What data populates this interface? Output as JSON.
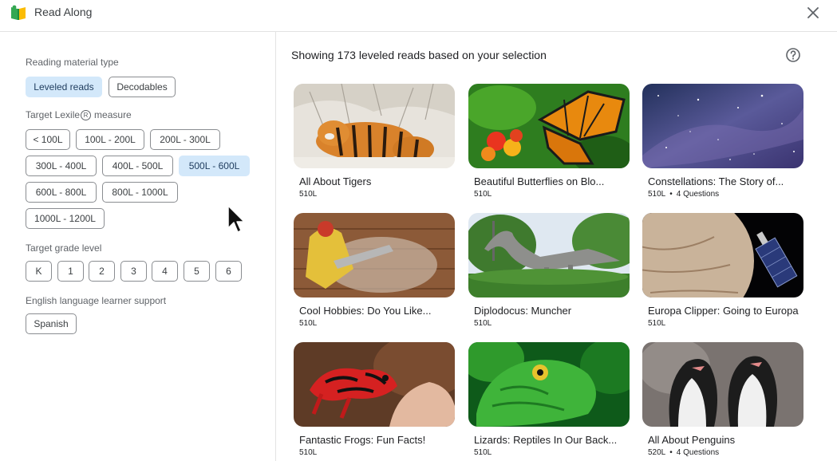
{
  "app": {
    "title": "Read Along",
    "close_icon": "close-icon",
    "logo_icon": "read-along-logo-icon"
  },
  "filters": {
    "material_label": "Reading material type",
    "material_options": [
      "Leveled reads",
      "Decodables"
    ],
    "lexile_label": "Target Lexile",
    "lexile_mark": "R",
    "lexile_suffix": "measure",
    "lexile_options": [
      "< 100L",
      "100L - 200L",
      "200L - 300L",
      "300L - 400L",
      "400L - 500L",
      "500L - 600L",
      "600L - 800L",
      "800L - 1000L",
      "1000L - 1200L"
    ],
    "lexile_selected": "500L - 600L",
    "grade_label": "Target grade level",
    "grade_options": [
      "K",
      "1",
      "2",
      "3",
      "4",
      "5",
      "6"
    ],
    "ell_label": "English language learner support",
    "ell_options": [
      "Spanish"
    ]
  },
  "results": {
    "summary": "Showing 173 leveled reads based on your selection",
    "help_icon": "help-circle-icon"
  },
  "books": [
    {
      "title": "All About Tigers",
      "level": "510L",
      "questions": ""
    },
    {
      "title": "Beautiful Butterflies on Blo...",
      "level": "510L",
      "questions": ""
    },
    {
      "title": "Constellations: The Story of...",
      "level": "510L",
      "questions": "4 Questions"
    },
    {
      "title": "Cool Hobbies: Do You Like...",
      "level": "510L",
      "questions": ""
    },
    {
      "title": "Diplodocus: Muncher",
      "level": "510L",
      "questions": ""
    },
    {
      "title": "Europa Clipper: Going to Europa",
      "level": "510L",
      "questions": ""
    },
    {
      "title": "Fantastic Frogs: Fun Facts!",
      "level": "510L",
      "questions": ""
    },
    {
      "title": "Lizards: Reptiles In Our Back...",
      "level": "510L",
      "questions": ""
    },
    {
      "title": "All About Penguins",
      "level": "520L",
      "questions": "4 Questions"
    }
  ],
  "colors": {
    "selected_chip": "#d3e8fa",
    "divider": "#e3e3e3"
  }
}
